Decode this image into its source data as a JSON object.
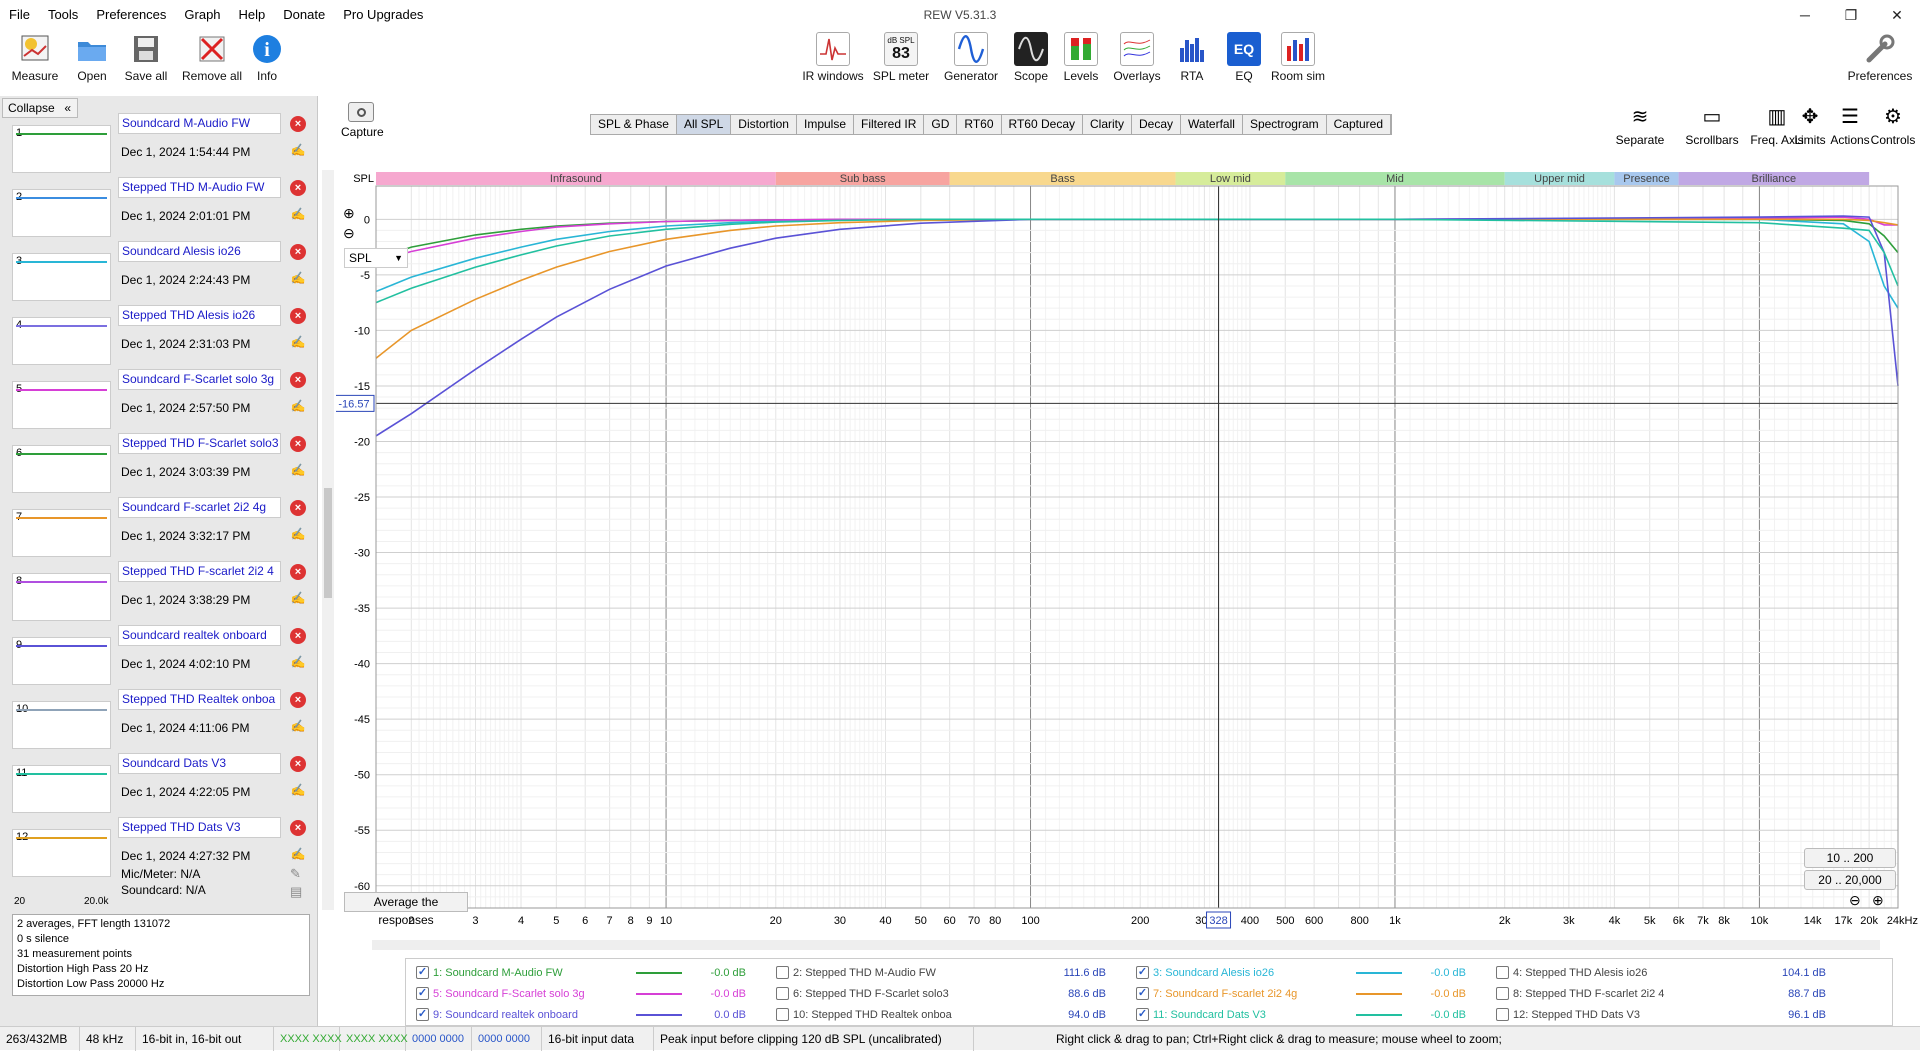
{
  "menu": [
    "File",
    "Tools",
    "Preferences",
    "Graph",
    "Help",
    "Donate",
    "Pro Upgrades"
  ],
  "window_title": "REW V5.31.3",
  "window_controls": [
    "─",
    "❐",
    "✕"
  ],
  "toolbar_left": [
    {
      "label": "Measure",
      "icon": "measure-icon"
    },
    {
      "label": "Open",
      "icon": "folder-icon"
    },
    {
      "label": "Save all",
      "icon": "save-icon"
    },
    {
      "label": "Remove all",
      "icon": "remove-icon"
    },
    {
      "label": "Info",
      "icon": "info-icon"
    }
  ],
  "toolbar_center": [
    {
      "label": "IR windows",
      "icon": "ir-icon"
    },
    {
      "label": "SPL meter",
      "icon": "spl-meter-icon",
      "badge_top": "dB SPL",
      "badge_val": "83"
    },
    {
      "label": "Generator",
      "icon": "generator-icon"
    },
    {
      "label": "Scope",
      "icon": "scope-icon"
    },
    {
      "label": "Levels",
      "icon": "levels-icon"
    },
    {
      "label": "Overlays",
      "icon": "overlays-icon"
    },
    {
      "label": "RTA",
      "icon": "rta-icon"
    },
    {
      "label": "EQ",
      "icon": "eq-icon"
    },
    {
      "label": "Room sim",
      "icon": "room-sim-icon"
    }
  ],
  "toolbar_right": {
    "label": "Preferences",
    "icon": "wrench-icon"
  },
  "collapse_label": "Collapse",
  "measurements": [
    {
      "num": "1",
      "name": "Soundcard M-Audio FW",
      "date": "Dec 1, 2024 1:54:44 PM",
      "color": "#2e9e3a"
    },
    {
      "num": "2",
      "name": "Stepped THD M-Audio FW",
      "date": "Dec 1, 2024 2:01:01 PM",
      "color": "#3b8de0"
    },
    {
      "num": "3",
      "name": "Soundcard  Alesis io26",
      "date": "Dec 1, 2024 2:24:43 PM",
      "color": "#29b6d6"
    },
    {
      "num": "4",
      "name": "Stepped THD Alesis io26",
      "date": "Dec 1, 2024 2:31:03 PM",
      "color": "#7b6fe0"
    },
    {
      "num": "5",
      "name": "Soundcard F-Scarlet solo 3g",
      "date": "Dec 1, 2024 2:57:50 PM",
      "color": "#d63fd6"
    },
    {
      "num": "6",
      "name": "Stepped THD F-Scarlet solo3",
      "date": "Dec 1, 2024 3:03:39 PM",
      "color": "#2e9e3a"
    },
    {
      "num": "7",
      "name": "Soundcard F-scarlet 2i2 4g",
      "date": "Dec 1, 2024 3:32:17 PM",
      "color": "#e8962a"
    },
    {
      "num": "8",
      "name": "Stepped THD  F-scarlet 2i2 4",
      "date": "Dec 1, 2024 3:38:29 PM",
      "color": "#b04fe0"
    },
    {
      "num": "9",
      "name": "Soundcard realtek onboard",
      "date": "Dec 1, 2024 4:02:10 PM",
      "color": "#5a52d6"
    },
    {
      "num": "10",
      "name": "Stepped THD Realtek onboa",
      "date": "Dec 1, 2024 4:11:06 PM",
      "color": "#8fa3b8"
    },
    {
      "num": "11",
      "name": "Soundcard Dats V3",
      "date": "Dec 1, 2024 4:22:05 PM",
      "color": "#22c0a0"
    },
    {
      "num": "12",
      "name": "Stepped THD Dats V3",
      "date": "Dec 1, 2024 4:27:32 PM",
      "color": "#e0a020"
    }
  ],
  "thumb_axis": {
    "left": "20",
    "right": "20.0k"
  },
  "mic_meter": "Mic/Meter: N/A",
  "soundcard": "Soundcard: N/A",
  "info_lines": [
    "2 averages, FFT length 131072",
    "0 s silence",
    "31 measurement points",
    "Distortion High Pass 20 Hz",
    "Distortion Low Pass 20000 Hz"
  ],
  "capture_label": "Capture",
  "tabs": [
    "SPL & Phase",
    "All SPL",
    "Distortion",
    "Impulse",
    "Filtered IR",
    "GD",
    "RT60",
    "RT60 Decay",
    "Clarity",
    "Decay",
    "Waterfall",
    "Spectrogram",
    "Captured"
  ],
  "active_tab": "All SPL",
  "right_buttons": [
    {
      "label": "Separate",
      "icon": "separate-icon"
    },
    {
      "label": "Scrollbars",
      "icon": "scrollbars-icon"
    },
    {
      "label": "Freq. Axis",
      "icon": "freq-axis-icon"
    },
    {
      "label": "Limits",
      "icon": "limits-icon"
    },
    {
      "label": "Actions",
      "icon": "actions-icon"
    },
    {
      "label": "Controls",
      "icon": "controls-icon"
    }
  ],
  "spl_dropdown": "SPL",
  "cursor_readout": {
    "y": "-16.57",
    "x": "328"
  },
  "zoom_buttons": [
    "10 .. 200",
    "20 .. 20,000"
  ],
  "average_button": "Average the responses",
  "bands": [
    {
      "name": "Infrasound",
      "lo": 1.6,
      "hi": 20,
      "color": "#f6a8cf"
    },
    {
      "name": "Sub bass",
      "lo": 20,
      "hi": 60,
      "color": "#f7a4a0"
    },
    {
      "name": "Bass",
      "lo": 60,
      "hi": 250,
      "color": "#f8d88e"
    },
    {
      "name": "Low mid",
      "lo": 250,
      "hi": 500,
      "color": "#d6ec9a"
    },
    {
      "name": "Mid",
      "lo": 500,
      "hi": 2000,
      "color": "#a8e4a8"
    },
    {
      "name": "Upper mid",
      "lo": 2000,
      "hi": 4000,
      "color": "#a6e0dc"
    },
    {
      "name": "Presence",
      "lo": 4000,
      "hi": 6000,
      "color": "#a8c8ee"
    },
    {
      "name": "Brilliance",
      "lo": 6000,
      "hi": 20000,
      "color": "#c0a8e4"
    }
  ],
  "chart_data": {
    "type": "line",
    "ylabel": "SPL",
    "xlim": [
      1.6,
      24000
    ],
    "ylim": [
      -62,
      3
    ],
    "log_x": true,
    "x_ticks": [
      {
        "v": 2,
        "t": "2"
      },
      {
        "v": 3,
        "t": "3"
      },
      {
        "v": 4,
        "t": "4"
      },
      {
        "v": 5,
        "t": "5"
      },
      {
        "v": 6,
        "t": "6"
      },
      {
        "v": 7,
        "t": "7"
      },
      {
        "v": 8,
        "t": "8"
      },
      {
        "v": 9,
        "t": "9"
      },
      {
        "v": 10,
        "t": "10"
      },
      {
        "v": 20,
        "t": "20"
      },
      {
        "v": 30,
        "t": "30"
      },
      {
        "v": 40,
        "t": "40"
      },
      {
        "v": 50,
        "t": "50"
      },
      {
        "v": 60,
        "t": "60"
      },
      {
        "v": 70,
        "t": "70"
      },
      {
        "v": 80,
        "t": "80"
      },
      {
        "v": 100,
        "t": "100"
      },
      {
        "v": 200,
        "t": "200"
      },
      {
        "v": 300,
        "t": "300"
      },
      {
        "v": 400,
        "t": "400"
      },
      {
        "v": 500,
        "t": "500"
      },
      {
        "v": 600,
        "t": "600"
      },
      {
        "v": 800,
        "t": "800"
      },
      {
        "v": 1000,
        "t": "1k"
      },
      {
        "v": 2000,
        "t": "2k"
      },
      {
        "v": 3000,
        "t": "3k"
      },
      {
        "v": 4000,
        "t": "4k"
      },
      {
        "v": 5000,
        "t": "5k"
      },
      {
        "v": 6000,
        "t": "6k"
      },
      {
        "v": 7000,
        "t": "7k"
      },
      {
        "v": 8000,
        "t": "8k"
      },
      {
        "v": 10000,
        "t": "10k"
      },
      {
        "v": 14000,
        "t": "14k"
      },
      {
        "v": 17000,
        "t": "17k"
      },
      {
        "v": 20000,
        "t": "20k"
      },
      {
        "v": 24000,
        "t": "24kHz"
      }
    ],
    "y_ticks": [
      0,
      -5,
      -10,
      -15,
      -20,
      -25,
      -30,
      -35,
      -40,
      -45,
      -50,
      -55,
      -60
    ],
    "cursor": {
      "x": 328,
      "y": -16.57
    },
    "series": [
      {
        "name": "1: Soundcard M-Audio FW",
        "color": "#2e9e3a",
        "x": [
          1.6,
          2,
          3,
          4,
          5,
          7,
          10,
          15,
          20,
          30,
          50,
          100,
          1000,
          10000,
          17000,
          20000,
          22000,
          24000
        ],
        "y": [
          -3.6,
          -2.5,
          -1.4,
          -0.9,
          -0.6,
          -0.35,
          -0.2,
          -0.1,
          -0.05,
          -0.02,
          0,
          0,
          0,
          0,
          -0.1,
          -0.4,
          -1.5,
          -3
        ]
      },
      {
        "name": "3: Soundcard Alesis io26",
        "color": "#29b6d6",
        "x": [
          1.6,
          2,
          3,
          4,
          5,
          7,
          10,
          15,
          20,
          30,
          50,
          100,
          1000,
          10000,
          17000,
          20000,
          22000,
          24000
        ],
        "y": [
          -6.5,
          -5.2,
          -3.5,
          -2.5,
          -1.8,
          -1.1,
          -0.6,
          -0.3,
          -0.15,
          -0.05,
          0,
          0,
          0,
          0,
          -0.4,
          -2,
          -6,
          -8
        ]
      },
      {
        "name": "5: Soundcard F-Scarlet solo 3g",
        "color": "#d63fd6",
        "x": [
          1.6,
          2,
          3,
          4,
          5,
          7,
          10,
          15,
          20,
          30,
          50,
          100,
          1000,
          10000,
          17000,
          20000,
          22000,
          24000
        ],
        "y": [
          -3.8,
          -2.9,
          -1.7,
          -1.1,
          -0.7,
          -0.4,
          -0.2,
          -0.1,
          -0.05,
          0,
          0,
          0,
          0,
          0.1,
          0.2,
          0,
          -0.5,
          -0.5
        ]
      },
      {
        "name": "7: Soundcard F-scarlet 2i2 4g",
        "color": "#e8962a",
        "x": [
          1.6,
          2,
          3,
          4,
          5,
          7,
          10,
          15,
          20,
          30,
          50,
          100,
          1000,
          10000,
          17000,
          20000,
          22000,
          24000
        ],
        "y": [
          -12.5,
          -10,
          -7.2,
          -5.5,
          -4.3,
          -2.9,
          -1.8,
          -1,
          -0.6,
          -0.3,
          -0.1,
          0,
          0,
          0,
          0,
          -0.1,
          -0.3,
          -0.5
        ]
      },
      {
        "name": "9: Soundcard realtek onboard",
        "color": "#5a52d6",
        "x": [
          1.6,
          2,
          3,
          4,
          5,
          7,
          10,
          15,
          20,
          30,
          50,
          100,
          1000,
          10000,
          17000,
          20000,
          22000,
          24000
        ],
        "y": [
          -19.5,
          -17.5,
          -13.5,
          -10.8,
          -8.8,
          -6.3,
          -4.2,
          -2.6,
          -1.7,
          -0.9,
          -0.35,
          0,
          0,
          0.2,
          0.3,
          0.2,
          -3,
          -15
        ]
      },
      {
        "name": "11: Soundcard Dats V3",
        "color": "#22c0a0",
        "x": [
          1.6,
          2,
          3,
          4,
          5,
          7,
          10,
          15,
          20,
          30,
          50,
          100,
          1000,
          10000,
          17000,
          20000,
          22000,
          24000
        ],
        "y": [
          -7.5,
          -6.2,
          -4.3,
          -3.2,
          -2.4,
          -1.5,
          -0.9,
          -0.45,
          -0.25,
          -0.1,
          0,
          0,
          0,
          -0.3,
          -0.8,
          -1,
          -3,
          -6
        ]
      }
    ]
  },
  "legend": [
    {
      "checked": true,
      "name": "1: Soundcard M-Audio FW",
      "value": "-0.0 dB",
      "color": "#2e9e3a",
      "inactive": false
    },
    {
      "checked": false,
      "name": "2: Stepped THD M-Audio FW",
      "value": "111.6 dB",
      "color": "",
      "inactive": true
    },
    {
      "checked": true,
      "name": "3: Soundcard  Alesis io26",
      "value": "-0.0 dB",
      "color": "#29b6d6",
      "inactive": false
    },
    {
      "checked": false,
      "name": "4: Stepped THD Alesis io26",
      "value": "104.1 dB",
      "color": "",
      "inactive": true
    },
    {
      "checked": true,
      "name": "5: Soundcard F-Scarlet solo 3g",
      "value": "-0.0 dB",
      "color": "#d63fd6",
      "inactive": false
    },
    {
      "checked": false,
      "name": "6: Stepped THD F-Scarlet solo3",
      "value": "88.6 dB",
      "color": "",
      "inactive": true
    },
    {
      "checked": true,
      "name": "7: Soundcard F-scarlet 2i2 4g",
      "value": "-0.0 dB",
      "color": "#e8962a",
      "inactive": false
    },
    {
      "checked": false,
      "name": "8: Stepped THD  F-scarlet 2i2 4",
      "value": "88.7 dB",
      "color": "",
      "inactive": true
    },
    {
      "checked": true,
      "name": "9: Soundcard realtek onboard",
      "value": "0.0 dB",
      "color": "#5a52d6",
      "inactive": false
    },
    {
      "checked": false,
      "name": "10: Stepped THD Realtek onboa",
      "value": "94.0 dB",
      "color": "",
      "inactive": true
    },
    {
      "checked": true,
      "name": "11: Soundcard Dats V3",
      "value": "-0.0 dB",
      "color": "#22c0a0",
      "inactive": false
    },
    {
      "checked": false,
      "name": "12: Stepped THD Dats V3",
      "value": "96.1 dB",
      "color": "",
      "inactive": true
    }
  ],
  "status": {
    "memory": "263/432MB",
    "rate": "48 kHz",
    "bits": "16-bit in, 16-bit out",
    "levels1": "XXXX XXXX",
    "levels2": "XXXX XXXX",
    "levels3": "0000 0000",
    "levels4": "0000 0000",
    "input": "16-bit input data",
    "peak": "Peak input before clipping 120 dB SPL (uncalibrated)",
    "hint": "Right click & drag to pan; Ctrl+Right click & drag to measure; mouse wheel to zoom;"
  }
}
